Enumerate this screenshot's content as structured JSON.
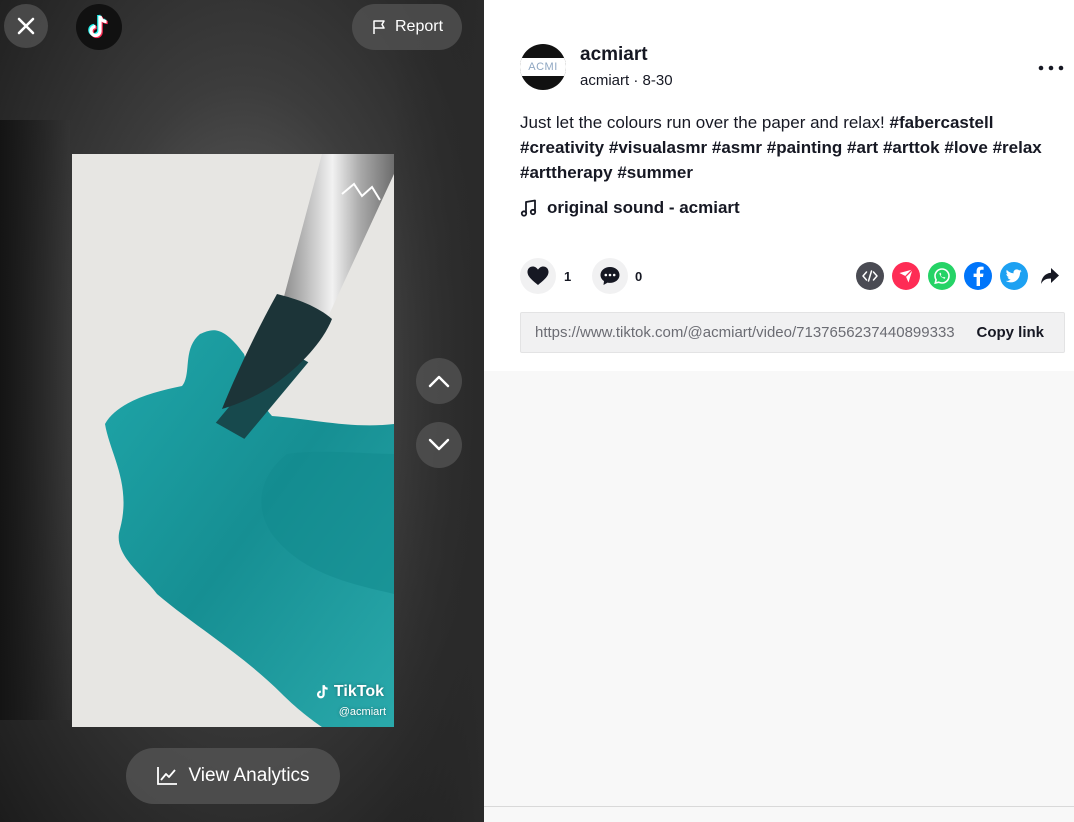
{
  "header": {
    "report_label": "Report"
  },
  "video": {
    "watermark_brand": "TikTok",
    "watermark_handle": "@acmiart"
  },
  "analytics": {
    "label": "View Analytics"
  },
  "author": {
    "display_name": "acmiart",
    "handle": "acmiart",
    "separator": "·",
    "date": "8-30",
    "avatar_text": "ACMI"
  },
  "post": {
    "desc_text": "Just let the colours run over the paper and relax!",
    "hashtags": [
      "#fabercastell",
      "#creativity",
      "#visualasmr",
      "#asmr",
      "#painting",
      "#art",
      "#arttok",
      "#love",
      "#relax",
      "#arttherapy",
      "#summer"
    ],
    "music": "original sound - acmiart"
  },
  "actions": {
    "likes": "1",
    "comments": "0"
  },
  "share": {
    "icons": [
      "embed-icon",
      "send-to-friends-icon",
      "whatsapp-icon",
      "facebook-icon",
      "twitter-icon",
      "share-more-icon"
    ],
    "colors": {
      "embed": "#4a4b53",
      "send": "#fe2c55",
      "whatsapp": "#25d366",
      "facebook": "#0075fa",
      "twitter": "#1da1f2"
    }
  },
  "link": {
    "url": "https://www.tiktok.com/@acmiart/video/7137656237440899333",
    "copy_label": "Copy link"
  }
}
